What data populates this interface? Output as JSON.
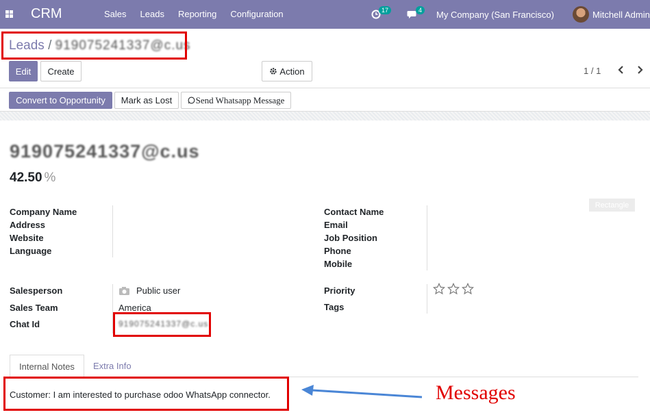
{
  "navbar": {
    "app_name": "CRM",
    "menu": [
      "Sales",
      "Leads",
      "Reporting",
      "Configuration"
    ],
    "activity_count": "17",
    "message_count": "4",
    "company": "My Company (San Francisco)",
    "user": "Mitchell Admin"
  },
  "breadcrumb": {
    "parent": "Leads",
    "separator": "/",
    "current": "919075241337@c.us"
  },
  "toolbar": {
    "edit": "Edit",
    "create": "Create",
    "action": "Action",
    "pager": "1 / 1"
  },
  "statusbar": {
    "convert": "Convert to Opportunity",
    "lost": "Mark as Lost",
    "whatsapp": "Send Whatsapp Message"
  },
  "record": {
    "title": "919075241337@c.us",
    "probability": "42.50",
    "probability_unit": "%",
    "ribbon": "Rectangle",
    "left_labels": [
      "Company Name",
      "Address",
      "Website",
      "Language"
    ],
    "right_labels": [
      "Contact Name",
      "Email",
      "Job Position",
      "Phone",
      "Mobile"
    ],
    "salesperson_label": "Salesperson",
    "salesperson": "Public user",
    "team_label": "Sales Team",
    "team": "America",
    "chat_label": "Chat Id",
    "chat_id": "919075241337@c.us",
    "priority_label": "Priority",
    "priority_value": 0,
    "tags_label": "Tags"
  },
  "tabs": [
    "Internal Notes",
    "Extra Info"
  ],
  "notes": "Customer: I am interested  to purchase odoo WhatsApp connector.",
  "annotation": {
    "label": "Messages",
    "color": "#e10000",
    "arrow_color": "#4a86d6"
  },
  "colors": {
    "brand": "#7c7bad",
    "badge": "#00a09d"
  }
}
